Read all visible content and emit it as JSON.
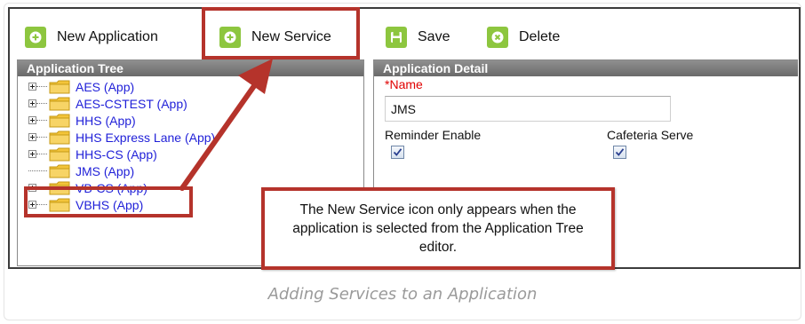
{
  "toolbar": {
    "new_application": "New Application",
    "new_service": "New Service",
    "save": "Save",
    "delete": "Delete"
  },
  "tree_panel": {
    "header": "Application Tree",
    "items": [
      {
        "label": "AES (App)",
        "expandable": true
      },
      {
        "label": "AES-CSTEST (App)",
        "expandable": true
      },
      {
        "label": "HHS (App)",
        "expandable": true
      },
      {
        "label": "HHS Express Lane (App)",
        "expandable": true
      },
      {
        "label": "HHS-CS (App)",
        "expandable": true
      },
      {
        "label": "JMS (App)",
        "expandable": false,
        "selected": true
      },
      {
        "label": "VB-CS (App)",
        "expandable": true
      },
      {
        "label": "VBHS (App)",
        "expandable": true
      }
    ]
  },
  "detail_panel": {
    "header": "Application Detail",
    "name_required_marker": "*",
    "name_label": "Name",
    "name_value": "JMS",
    "reminder_label": "Reminder Enable",
    "reminder_checked": true,
    "cafeteria_label": "Cafeteria Serve",
    "cafeteria_checked": true
  },
  "callout": {
    "text": "The New Service icon only appears when the application is selected from the Application Tree editor."
  },
  "caption": "Adding Services to an Application",
  "colors": {
    "accent_green": "#8dc63f",
    "highlight_red": "#b5332b",
    "tree_link": "#1f1fd8",
    "required_red": "#e00000"
  },
  "icons": {
    "new_application": "plus-circle-icon",
    "new_service": "plus-circle-icon",
    "save": "floppy-disk-icon",
    "delete": "x-circle-icon",
    "tree_folder": "folder-icon"
  }
}
